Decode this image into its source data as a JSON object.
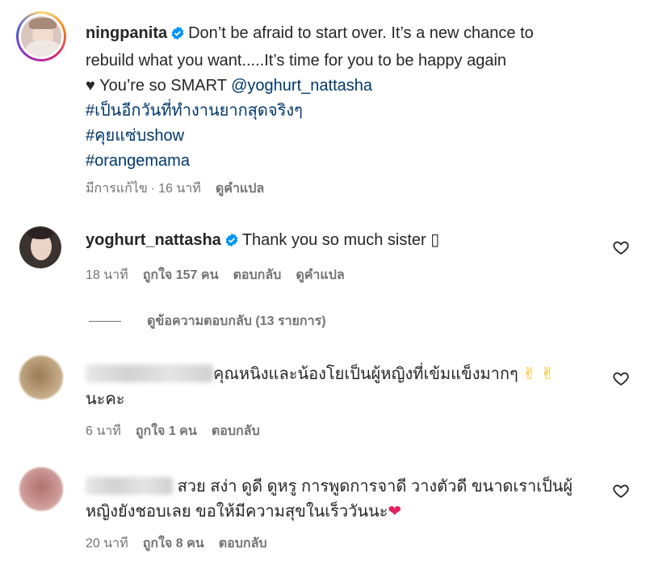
{
  "comments": [
    {
      "username": "ningpanita",
      "text_line1": "Don’t be afraid to start over. It’s a new chance to",
      "text_line2": "rebuild what you want.....It’s time for you to be happy again",
      "text_line3_prefix": "♥ You’re so SMART",
      "mention": "@yoghurt_nattasha",
      "hashtags": [
        "#เป็นอีกวันที่ทำงานยากสุดจริงๆ",
        "#คุยแซ่บshow",
        "#orangemama"
      ],
      "edited_label": "มีการแก้ไข",
      "time": "16 นาที",
      "translate": "ดูคำแปล"
    },
    {
      "username": "yoghurt_nattasha",
      "text": "Thank you so much sister",
      "emoji_missing": "▯",
      "time": "18 นาที",
      "likes": "ถูกใจ 157 คน",
      "reply": "ตอบกลับ",
      "translate": "ดูคำแปล",
      "view_replies": "ดูข้อความตอบกลับ (13 รายการ)"
    },
    {
      "text_line1": "คุณหนิงและน้องโยเป็นผู้หญิงที่เข้มแข็งมากๆ",
      "emoji": "✌ ✌",
      "text_line2": "นะคะ",
      "time": "6 นาที",
      "likes": "ถูกใจ 1 คน",
      "reply": "ตอบกลับ"
    },
    {
      "text_line1": "สวย สง่า ดูดี ดูหรู การพูดการจาดี วางตัวดี ขนาดเราเป็นผู้",
      "text_line2": "หญิงยังชอบเลย ขอให้มีความสุขในเร็ววันนะ",
      "emoji": "❤",
      "time": "20 นาที",
      "likes": "ถูกใจ 8 คน",
      "reply": "ตอบกลับ"
    }
  ],
  "icons": {
    "verified": "verified-badge-icon",
    "heart": "heart-outline-icon"
  },
  "colors": {
    "verified": "#0095f6",
    "link": "#00376b",
    "secondary": "#737373",
    "heart_emoji": "#e0245e"
  }
}
